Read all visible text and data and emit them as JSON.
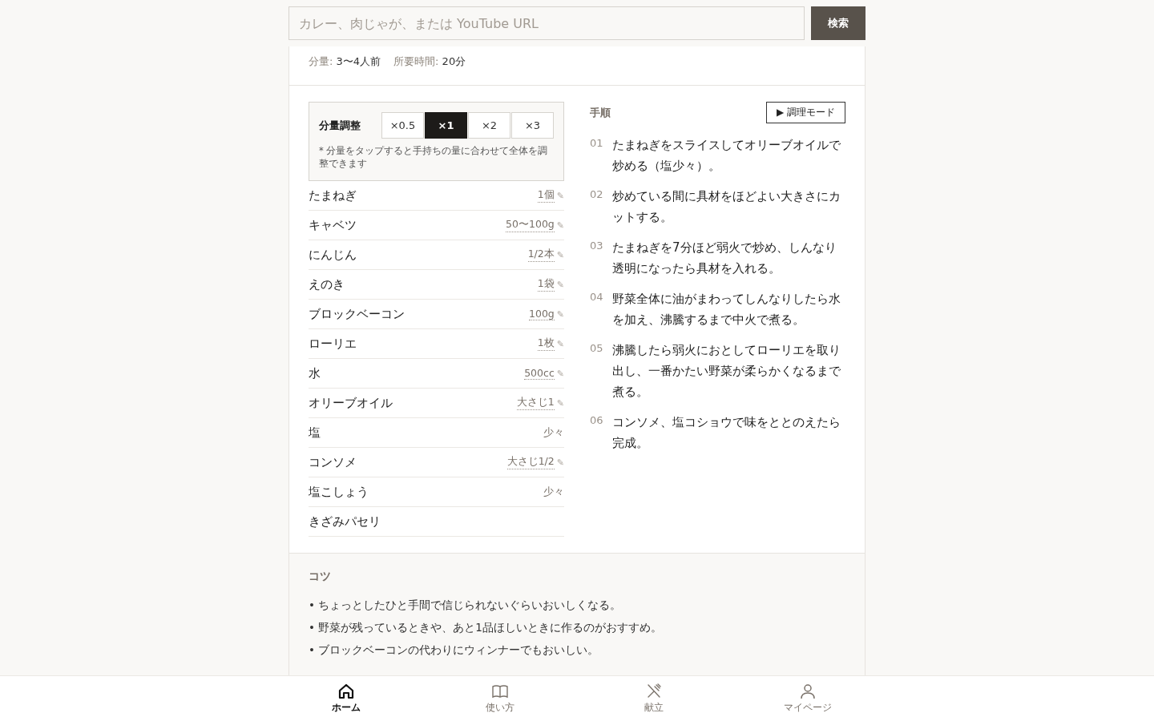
{
  "search": {
    "placeholder": "カレー、肉じゃが、または YouTube URL",
    "button": "検索"
  },
  "meta": [
    {
      "label": "分量:",
      "value": "3〜4人前"
    },
    {
      "label": "所要時間:",
      "value": "20分"
    }
  ],
  "scale": {
    "title": "分量調整",
    "options": [
      {
        "label": "×0.5",
        "selected": false
      },
      {
        "label": "×1",
        "selected": true
      },
      {
        "label": "×2",
        "selected": false
      },
      {
        "label": "×3",
        "selected": false
      }
    ],
    "note": "* 分量をタップすると手持ちの量に合わせて全体を調整できます"
  },
  "ingredients": [
    {
      "name": "たまねぎ",
      "amount": "1個",
      "edit_icon": "✎"
    },
    {
      "name": "キャベツ",
      "amount": "50〜100g",
      "edit_icon": "✎"
    },
    {
      "name": "にんじん",
      "amount": "1/2本",
      "edit_icon": "✎"
    },
    {
      "name": "えのき",
      "amount": "1袋",
      "edit_icon": "✎"
    },
    {
      "name": "ブロックベーコン",
      "amount": "100g",
      "edit_icon": "✎"
    },
    {
      "name": "ローリエ",
      "amount": "1枚",
      "edit_icon": "✎"
    },
    {
      "name": "水",
      "amount": "500cc",
      "edit_icon": "✎"
    },
    {
      "name": "オリーブオイル",
      "amount": "大さじ1",
      "edit_icon": "✎"
    },
    {
      "name": "塩",
      "amount": "少々"
    },
    {
      "name": "コンソメ",
      "amount": "大さじ1/2",
      "edit_icon": "✎"
    },
    {
      "name": "塩こしょう",
      "amount": "少々"
    },
    {
      "name": "きざみパセリ"
    }
  ],
  "steps_title": "手順",
  "cook_mode": "▶ 調理モード",
  "steps": [
    {
      "number": "01",
      "text": "たまねぎをスライスしてオリーブオイルで炒める（塩少々）。"
    },
    {
      "number": "02",
      "text": "炒めている間に具材をほどよい大きさにカットする。"
    },
    {
      "number": "03",
      "text": "たまねぎを7分ほど弱火で炒め、しんなり透明になったら具材を入れる。"
    },
    {
      "number": "04",
      "text": "野菜全体に油がまわってしんなりしたら水を加え、沸騰するまで中火で煮る。"
    },
    {
      "number": "05",
      "text": "沸騰したら弱火におとしてローリエを取り出し、一番かたい野菜が柔らかくなるまで煮る。"
    },
    {
      "number": "06",
      "text": "コンソメ、塩コショウで味をととのえたら完成。"
    }
  ],
  "tips_title": "コツ",
  "tips": [
    "• ちょっとしたひと手間で信じられないぐらいおいしくなる。",
    "• 野菜が残っているときや、あと1品ほしいときに作るのがおすすめ。",
    "• ブロックベーコンの代わりにウィンナーでもおいしい。"
  ],
  "nav": [
    {
      "kind": "home",
      "label": "ホーム",
      "selected": true
    },
    {
      "kind": "guide",
      "label": "使い方",
      "selected": false
    },
    {
      "kind": "menu",
      "label": "献立",
      "selected": false
    },
    {
      "kind": "mypage",
      "label": "マイページ",
      "selected": false
    }
  ]
}
